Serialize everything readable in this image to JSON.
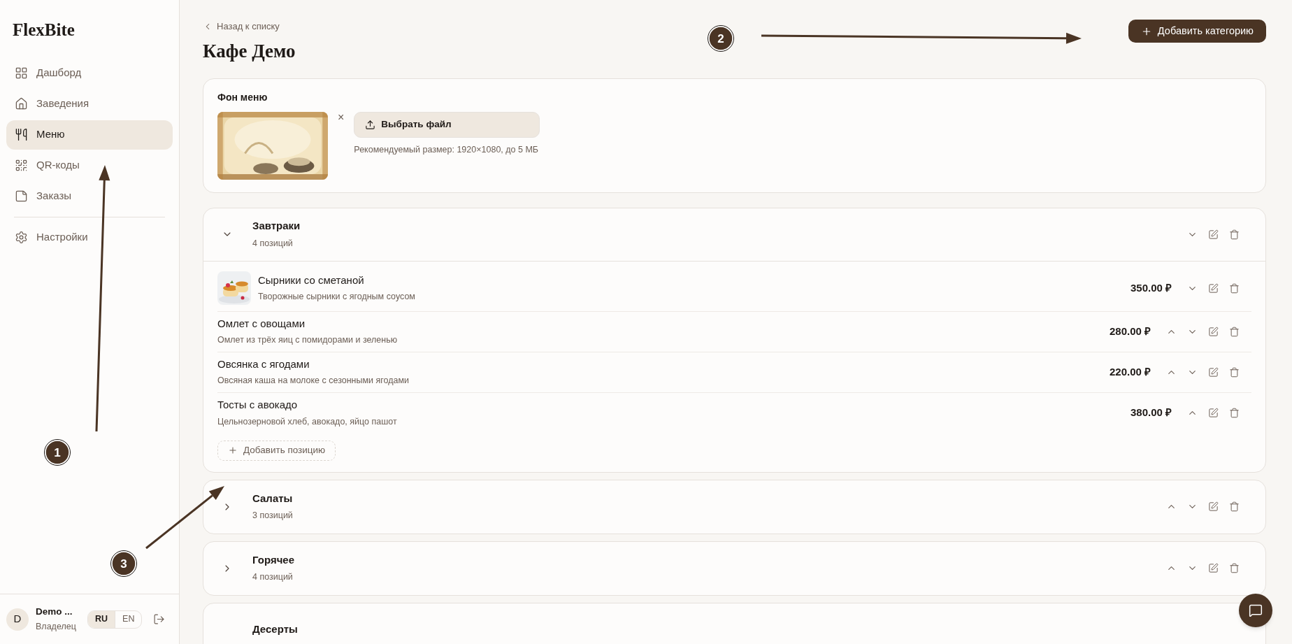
{
  "sidebar": {
    "logo": "FlexBite",
    "items": [
      {
        "label": "Дашборд",
        "selected": false
      },
      {
        "label": "Заведения",
        "selected": false
      },
      {
        "label": "Меню",
        "selected": true
      },
      {
        "label": "QR-коды",
        "selected": false
      },
      {
        "label": "Заказы",
        "selected": false
      }
    ],
    "settings": {
      "label": "Настройки",
      "selected": false
    },
    "user": {
      "avatar": "D",
      "name": "Demo ...",
      "role": "Владелец"
    },
    "languages": [
      {
        "label": "RU",
        "selected": true
      },
      {
        "label": "EN",
        "selected": false
      }
    ]
  },
  "header": {
    "back_link": "Назад к списку",
    "title": "Кафе Демо",
    "add_category_button": "Добавить категорию"
  },
  "background_card": {
    "title": "Фон меню",
    "remove": "×",
    "choose_file_button": "Выбрать файл",
    "hint": "Рекомендуемый размер: 1920×1080, до 5 МБ"
  },
  "categories": [
    {
      "name": "Завтраки",
      "count": "4 позиций",
      "expanded": true,
      "can_move_up": false,
      "can_move_down": true,
      "items": [
        {
          "name": "Сырники со сметаной",
          "description": "Творожные сырники с ягодным соусом",
          "price": "350.00 ₽",
          "can_move_up": false,
          "can_move_down": true
        },
        {
          "name": "Омлет с овощами",
          "description": "Омлет из трёх яиц с помидорами и зеленью",
          "price": "280.00 ₽",
          "can_move_up": true,
          "can_move_down": true
        },
        {
          "name": "Овсянка с ягодами",
          "description": "Овсяная каша на молоке с сезонными ягодами",
          "price": "220.00 ₽",
          "can_move_up": true,
          "can_move_down": true
        },
        {
          "name": "Тосты с авокадо",
          "description": "Цельнозерновой хлеб, авокадо, яйцо пашот",
          "price": "380.00 ₽",
          "can_move_up": true,
          "can_move_down": false
        }
      ],
      "add_item_button": "Добавить позицию"
    },
    {
      "name": "Салаты",
      "count": "3 позиций",
      "expanded": false,
      "can_move_up": true,
      "can_move_down": true
    },
    {
      "name": "Горячее",
      "count": "4 позиций",
      "expanded": false,
      "can_move_up": true,
      "can_move_down": true
    },
    {
      "name": "Десерты"
    }
  ],
  "annotations": [
    {
      "label": "1"
    },
    {
      "label": "2"
    },
    {
      "label": "3"
    }
  ]
}
